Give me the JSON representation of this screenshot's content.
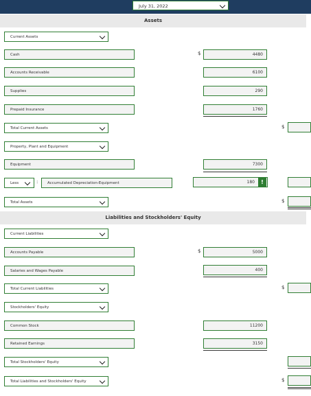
{
  "header": {
    "date": "July 31, 2022"
  },
  "sections": {
    "assets": "Assets",
    "liabilities_equity": "Liabilities and Stockholders' Equity"
  },
  "dollar_sign": "$",
  "colon": ":",
  "lines": {
    "current_assets": "Current Assets",
    "cash": {
      "label": "Cash",
      "value": "4480"
    },
    "accounts_receivable": {
      "label": "Accounts Receivable",
      "value": "6100"
    },
    "supplies": {
      "label": "Supplies",
      "value": "290"
    },
    "prepaid_insurance": {
      "label": "Prepaid Insurance",
      "value": "1760"
    },
    "total_current_assets": "Total Current Assets",
    "ppe": "Property, Plant and Equipment",
    "equipment": {
      "label": "Equipment",
      "value": "7300"
    },
    "less": "Less",
    "accum_dep": {
      "label": "Accumulated Depreciation-Equipment",
      "value": "180"
    },
    "total_assets": "Total Assets",
    "current_liabilities": "Current Liabilities",
    "accounts_payable": {
      "label": "Accounts Payable",
      "value": "5000"
    },
    "salaries_payable": {
      "label": "Salaries and Wages Payable",
      "value": "400"
    },
    "total_current_liabilities": "Total Current Liabilities",
    "stockholders_equity": "Stockholders' Equity",
    "common_stock": {
      "label": "Common Stock",
      "value": "11200"
    },
    "retained_earnings": {
      "label": "Retained Earnings",
      "value": "3150"
    },
    "total_se": "Total Stockholders' Equity",
    "total_le": "Total Liabilities and Stockholders' Equity"
  },
  "badge": "!"
}
